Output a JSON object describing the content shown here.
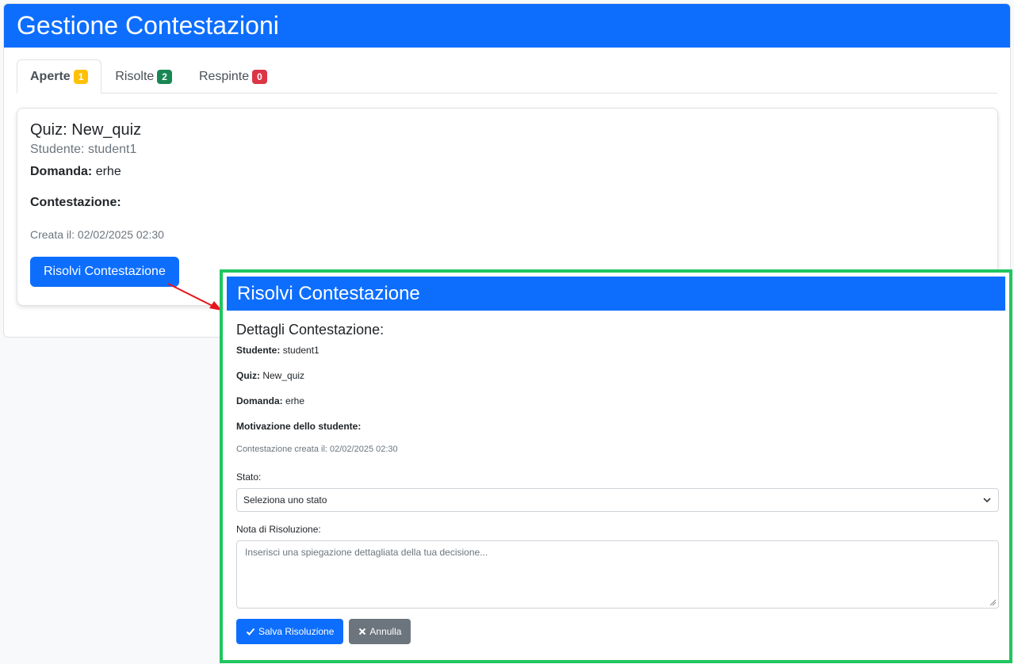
{
  "page": {
    "title": "Gestione Contestazioni"
  },
  "tabs": [
    {
      "label": "Aperte",
      "count": "1"
    },
    {
      "label": "Risolte",
      "count": "2"
    },
    {
      "label": "Respinte",
      "count": "0"
    }
  ],
  "dispute": {
    "quiz_prefix": "Quiz: ",
    "quiz": "New_quiz",
    "student_prefix": "Studente: ",
    "student": "student1",
    "question_label": "Domanda:",
    "question": "erhe",
    "dispute_label": "Contestazione:",
    "created": "Creata il: 02/02/2025 02:30",
    "resolve_button": "Risolvi Contestazione"
  },
  "modal": {
    "title": "Risolvi Contestazione",
    "details_title": "Dettagli Contestazione:",
    "student_label": "Studente:",
    "student": "student1",
    "quiz_label": "Quiz:",
    "quiz": "New_quiz",
    "question_label": "Domanda:",
    "question": "erhe",
    "motivation_label": "Motivazione dello studente:",
    "created": "Contestazione creata il: 02/02/2025 02:30",
    "status_label": "Stato:",
    "status_value": "Seleziona uno stato",
    "note_label": "Nota di Risoluzione:",
    "note_placeholder": "Inserisci una spiegazione dettagliata della tua decisione...",
    "save_button": "Salva Risoluzione",
    "cancel_button": "Annulla"
  },
  "colors": {
    "primary": "#0d6efd",
    "highlight_frame": "#1fc65f",
    "warning": "#ffc107",
    "success": "#198754",
    "danger": "#dc3545",
    "secondary": "#6c757d"
  },
  "icons": [
    "chevron-down-icon",
    "check-icon",
    "times-icon",
    "resize-grip-icon",
    "annotation-arrow"
  ]
}
